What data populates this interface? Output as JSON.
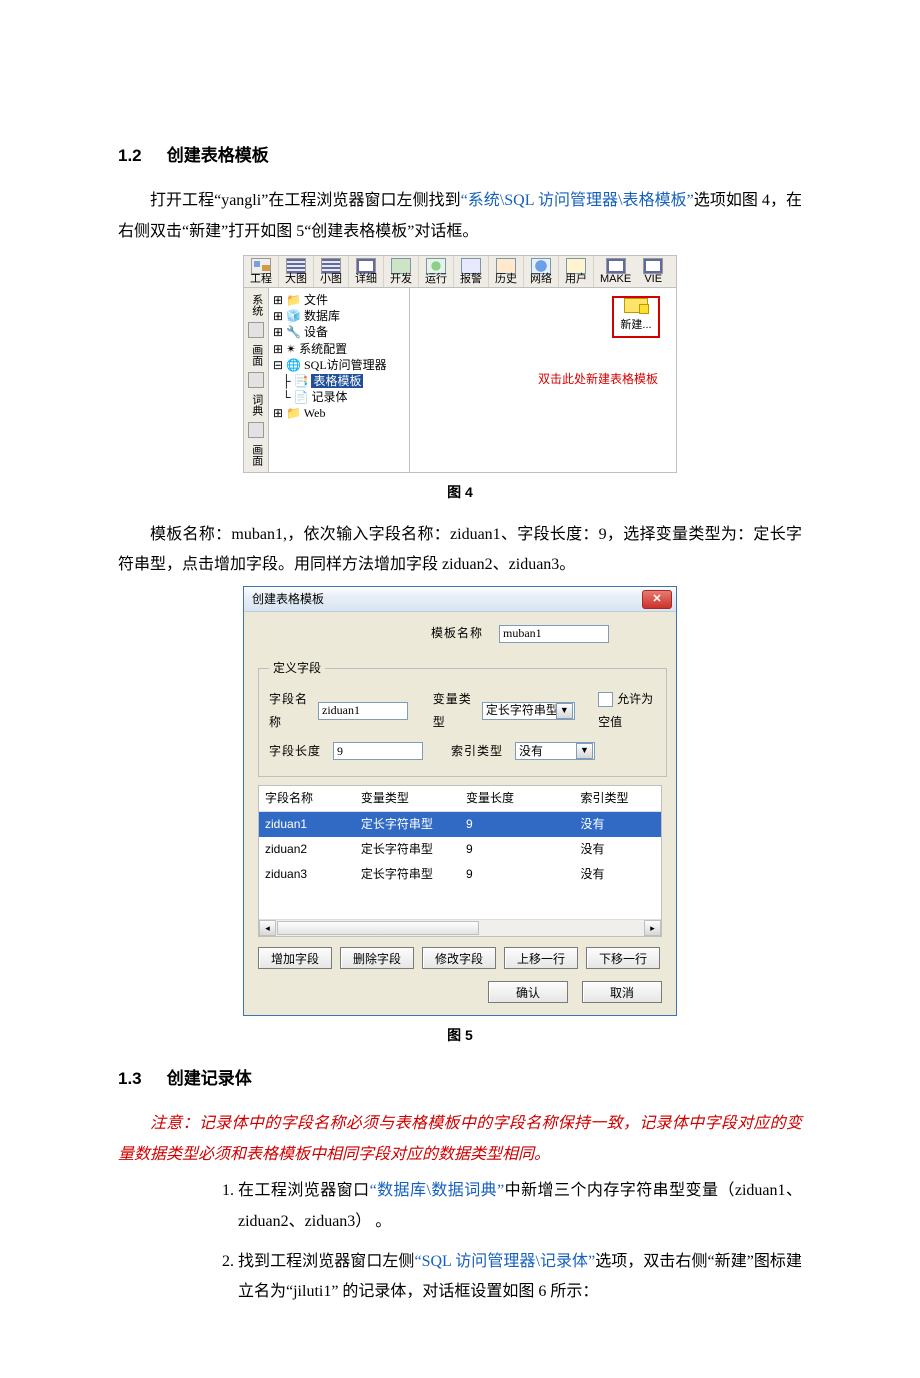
{
  "sections": {
    "s12_num": "1.2",
    "s12_title": "创建表格模板",
    "s13_num": "1.3",
    "s13_title": "创建记录体"
  },
  "para1a": "打开工程“yangli”在工程浏览器窗口左侧找到",
  "para1b": "“系统\\SQL 访问管理器\\表格模板”",
  "para1c": "选项如图 4，在右侧双击“新建”打开如图 5“创建表格模板”对话框。",
  "fig4_caption": "图 4",
  "para2": "模板名称：muban1,，依次输入字段名称：ziduan1、字段长度：9，选择变量类型为：定长字符串型，点击增加字段。用同样方法增加字段 ziduan2、ziduan3。",
  "fig5_caption": "图 5",
  "note_a": "注意：记录体中的字段名称必须与表格模板中的字段名称保持一致，记录体中字段对应的变量数据类型必须和表格模板中相同字段对应的数据类型相同。",
  "ol": {
    "i1a": "在工程浏览器窗口",
    "i1b": "“数据库\\数据词典”",
    "i1c": "中新增三个内存字符串型变量（ziduan1、 ziduan2、ziduan3） 。",
    "i2a": "找到工程浏览器窗口左侧",
    "i2b": "“SQL 访问管理器\\记录体”",
    "i2c": "选项，双击右侧“新建”图标建立名为“jiluti1” 的记录体，对话框设置如图 6 所示："
  },
  "fig4": {
    "toolbar": [
      "工程",
      "大图",
      "小图",
      "详细",
      "开发",
      "运行",
      "报警",
      "历史",
      "网络",
      "用户",
      "MAKE",
      "VIE"
    ],
    "vtabs": [
      "系统",
      "",
      "画面",
      "",
      "词典",
      "",
      "画面"
    ],
    "tree": {
      "file": "文件",
      "db": "数据库",
      "dev": "设备",
      "cfg": "系统配置",
      "sql": "SQL访问管理器",
      "tpl": "表格模板",
      "rec": "记录体",
      "web": "Web"
    },
    "new_label": "新建...",
    "hint": "双击此处新建表格模板"
  },
  "fig5": {
    "title": "创建表格模板",
    "labels": {
      "tpl_name": "模板名称",
      "grp": "定义字段",
      "field_name": "字段名称",
      "var_type": "变量类型",
      "allow_null": "允许为空值",
      "field_len": "字段长度",
      "idx_type": "索引类型"
    },
    "values": {
      "tpl_name": "muban1",
      "field_name": "ziduan1",
      "var_type": "定长字符串型",
      "field_len": "9",
      "idx_type": "没有"
    },
    "columns": [
      "字段名称",
      "变量类型",
      "变量长度",
      "索引类型"
    ],
    "rows": [
      {
        "name": "ziduan1",
        "type": "定长字符串型",
        "len": "9",
        "idx": "没有",
        "sel": true
      },
      {
        "name": "ziduan2",
        "type": "定长字符串型",
        "len": "9",
        "idx": "没有",
        "sel": false
      },
      {
        "name": "ziduan3",
        "type": "定长字符串型",
        "len": "9",
        "idx": "没有",
        "sel": false
      }
    ],
    "buttons": {
      "add": "增加字段",
      "del": "删除字段",
      "mod": "修改字段",
      "up": "上移一行",
      "down": "下移一行",
      "ok": "确认",
      "cancel": "取消"
    }
  }
}
